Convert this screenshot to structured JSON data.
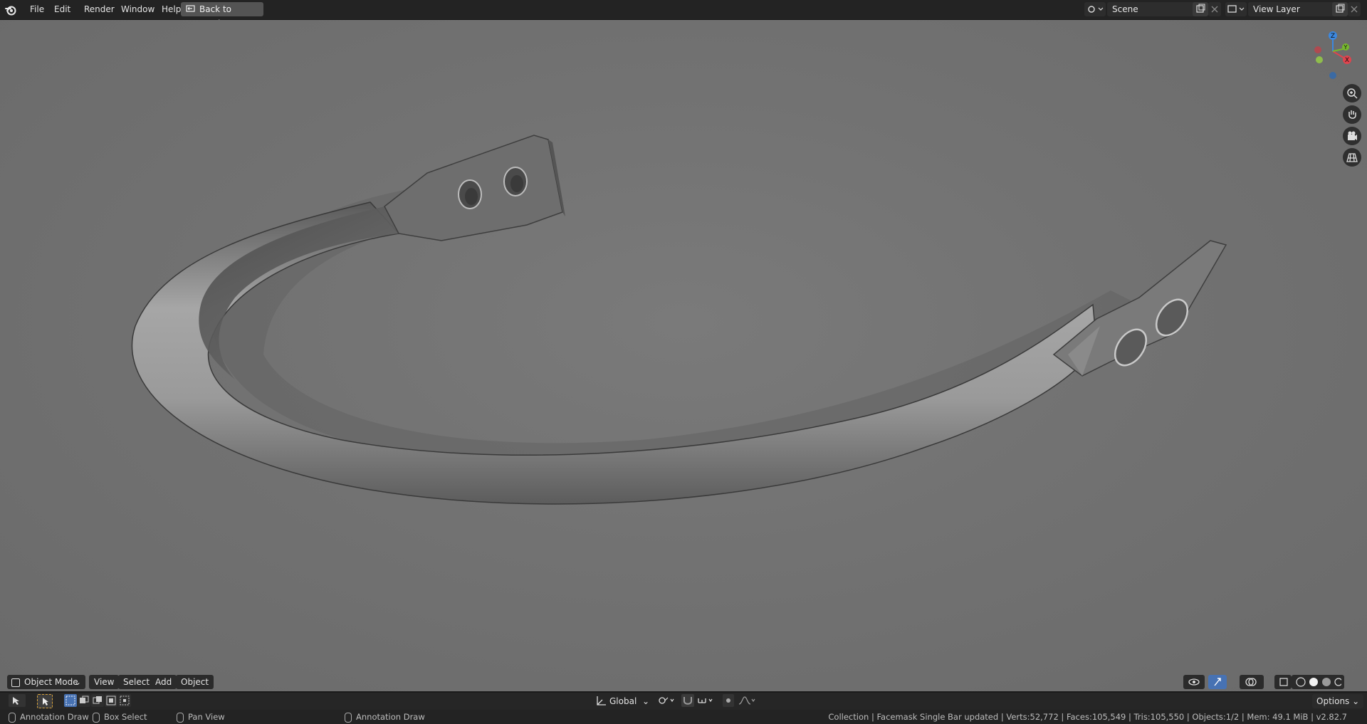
{
  "topbar": {
    "menus": [
      "File",
      "Edit",
      "Render",
      "Window",
      "Help"
    ],
    "back_button": "Back to Previous",
    "scene": "Scene",
    "view_layer": "View Layer"
  },
  "viewport": {
    "object_name": "Facemask Single Bar",
    "axis_labels": {
      "x": "X",
      "y": "Y",
      "z": "Z"
    }
  },
  "header": {
    "mode": "Object Mode",
    "menus": [
      "View",
      "Select",
      "Add",
      "Object"
    ],
    "transform_orientation": "Global",
    "options": "Options"
  },
  "statusbar": {
    "left_action": "Annotation Draw",
    "middle1_action": "Box Select",
    "middle2_action": "Pan View",
    "right_action": "Annotation Draw",
    "stats": "Collection | Facemask Single Bar updated | Verts:52,772 | Faces:105,549 | Tris:105,550 | Objects:1/2 | Mem: 49.1 MiB | v2.82.7"
  },
  "colors": {
    "accent": "#4772b3",
    "axis_x": "#e0444e",
    "axis_y": "#77b92d",
    "axis_z": "#3c88e0"
  }
}
